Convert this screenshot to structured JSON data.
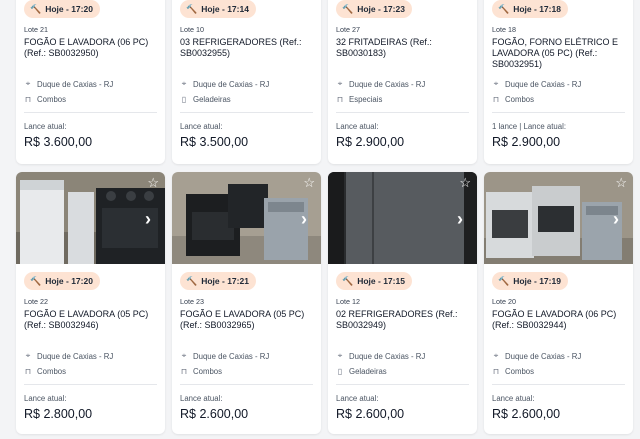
{
  "lots": [
    {
      "time": "Hoje - 17:20",
      "lote": "Lote 21",
      "title": "FOGÃO E LAVADORA (06 PC) (Ref.: SB0032950)",
      "location": "Duque de Caxias - RJ",
      "category": "Combos",
      "category_icon": "sofa-icon",
      "lance_label": "Lance atual:",
      "price": "R$ 3.600,00"
    },
    {
      "time": "Hoje - 17:14",
      "lote": "Lote 10",
      "title": "03 REFRIGERADORES (Ref.: SB0032955)",
      "location": "Duque de Caxias - RJ",
      "category": "Geladeiras",
      "category_icon": "fridge-icon",
      "lance_label": "Lance atual:",
      "price": "R$ 3.500,00"
    },
    {
      "time": "Hoje - 17:23",
      "lote": "Lote 27",
      "title": "32 FRITADEIRAS (Ref.: SB0030183)",
      "location": "Duque de Caxias - RJ",
      "category": "Especiais",
      "category_icon": "sofa-icon",
      "lance_label": "Lance atual:",
      "price": "R$ 2.900,00"
    },
    {
      "time": "Hoje - 17:18",
      "lote": "Lote 18",
      "title": "FOGÃO, FORNO ELÉTRICO E LAVADORA (05 PC) (Ref.: SB0032951)",
      "location": "Duque de Caxias - RJ",
      "category": "Combos",
      "category_icon": "sofa-icon",
      "lance_label": "1 lance | Lance atual:",
      "price": "R$ 2.900,00"
    },
    {
      "time": "Hoje - 17:20",
      "lote": "Lote 22",
      "title": "FOGÃO E LAVADORA (05 PC) (Ref.: SB0032946)",
      "location": "Duque de Caxias - RJ",
      "category": "Combos",
      "category_icon": "sofa-icon",
      "lance_label": "Lance atual:",
      "price": "R$ 2.800,00"
    },
    {
      "time": "Hoje - 17:21",
      "lote": "Lote 23",
      "title": "FOGÃO E LAVADORA (05 PC) (Ref.: SB0032965)",
      "location": "Duque de Caxias - RJ",
      "category": "Combos",
      "category_icon": "sofa-icon",
      "lance_label": "Lance atual:",
      "price": "R$ 2.600,00"
    },
    {
      "time": "Hoje - 17:15",
      "lote": "Lote 12",
      "title": "02 REFRIGERADORES (Ref.: SB0032949)",
      "location": "Duque de Caxias - RJ",
      "category": "Geladeiras",
      "category_icon": "fridge-icon",
      "lance_label": "Lance atual:",
      "price": "R$ 2.600,00"
    },
    {
      "time": "Hoje - 17:19",
      "lote": "Lote 20",
      "title": "FOGÃO E LAVADORA (06 PC) (Ref.: SB0032944)",
      "location": "Duque de Caxias - RJ",
      "category": "Combos",
      "category_icon": "sofa-icon",
      "lance_label": "Lance atual:",
      "price": "R$ 2.600,00"
    }
  ],
  "icons": {
    "hammer": "auction-hammer-icon",
    "location": "location-pin-icon",
    "favorite": "star-outline-icon",
    "next": "chevron-right-icon"
  },
  "colors": {
    "badge_bg": "#fde3d3",
    "page_bg": "#f3f4f6"
  }
}
